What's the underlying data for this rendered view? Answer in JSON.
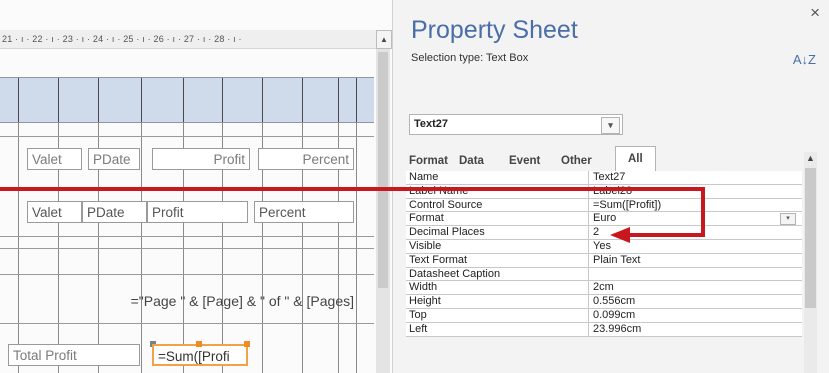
{
  "report": {
    "ruler_text": "21 · ı · 22 · ı · 23 · ı · 24 · ı · 25 · ı · 26 · ı · 27 · ı · 28 · ı ·",
    "ruler_arrow": "▲",
    "row1": {
      "valet": "Valet",
      "pdate": "PDate",
      "profit": "Profit",
      "percent": "Percent"
    },
    "row2": {
      "valet": "Valet",
      "pdate": "PDate",
      "profit": "Profit",
      "percent": "Percent"
    },
    "page_expr": "=\"Page \" & [Page] & \" of \" & [Pages]",
    "total_label": "Total Profit",
    "total_expr": "=Sum([Profi"
  },
  "property_sheet": {
    "title": "Property Sheet",
    "close": "×",
    "selection_type": "Selection type:  Text Box",
    "sort_icon": "A↓Z",
    "selected_control": "Text27",
    "dropdown_arrow": "▾",
    "tabs": [
      "Format",
      "Data",
      "Event",
      "Other",
      "All"
    ],
    "active_tab": "All",
    "properties": [
      {
        "name": "Name",
        "value": "Text27"
      },
      {
        "name": "Label Name",
        "value": "Label28"
      },
      {
        "name": "Control Source",
        "value": "=Sum([Profit])"
      },
      {
        "name": "Format",
        "value": "Euro"
      },
      {
        "name": "Decimal Places",
        "value": "2"
      },
      {
        "name": "Visible",
        "value": "Yes"
      },
      {
        "name": "Text Format",
        "value": "Plain Text"
      },
      {
        "name": "Datasheet Caption",
        "value": ""
      },
      {
        "name": "Width",
        "value": "2cm"
      },
      {
        "name": "Height",
        "value": "0.556cm"
      },
      {
        "name": "Top",
        "value": "0.099cm"
      },
      {
        "name": "Left",
        "value": "23.996cm"
      }
    ],
    "scroll_up": "▲"
  },
  "colors": {
    "title": "#4a6ea8",
    "callout": "#c8171f",
    "selection": "#f08a24",
    "header_band": "#cfdaea"
  }
}
